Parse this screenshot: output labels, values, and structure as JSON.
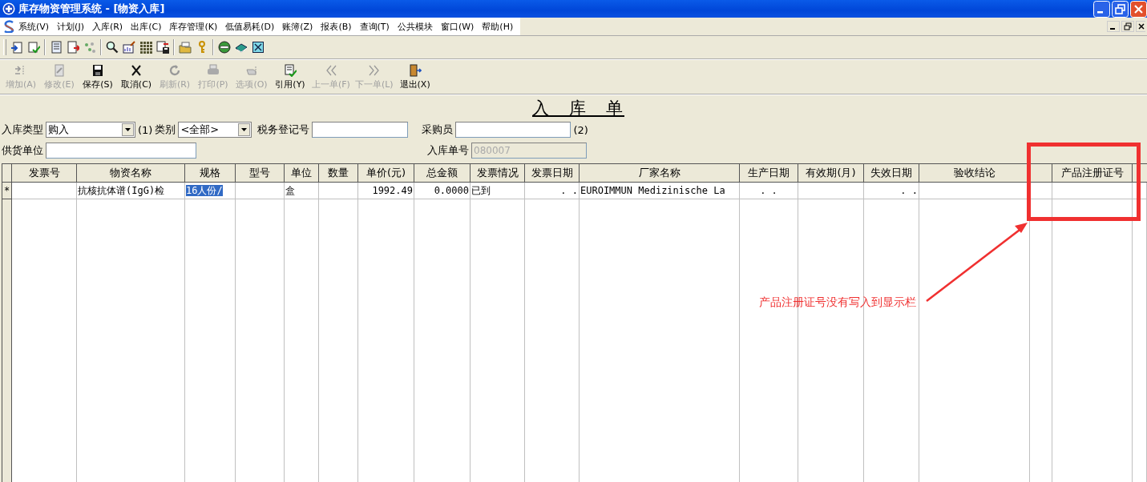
{
  "window": {
    "title": "库存物资管理系统 - [物资入库]"
  },
  "menu": [
    "系统(V)",
    "计划(J)",
    "入库(R)",
    "出库(C)",
    "库存管理(K)",
    "低值易耗(D)",
    "账簿(Z)",
    "报表(B)",
    "查询(T)",
    "公共模块",
    "窗口(W)",
    "帮助(H)"
  ],
  "actions": [
    {
      "label": "增加(A)",
      "disabled": true,
      "kind": "add"
    },
    {
      "label": "修改(E)",
      "disabled": true,
      "kind": "edit"
    },
    {
      "label": "保存(S)",
      "disabled": false,
      "kind": "save"
    },
    {
      "label": "取消(C)",
      "disabled": false,
      "kind": "cancel"
    },
    {
      "label": "刷新(R)",
      "disabled": true,
      "kind": "refresh"
    },
    {
      "label": "打印(P)",
      "disabled": true,
      "kind": "print"
    },
    {
      "label": "选项(O)",
      "disabled": true,
      "kind": "options"
    },
    {
      "label": "引用(Y)",
      "disabled": false,
      "kind": "quote"
    },
    {
      "label": "上一单(F)",
      "disabled": true,
      "kind": "prev"
    },
    {
      "label": "下一单(L)",
      "disabled": true,
      "kind": "next"
    },
    {
      "label": "退出(X)",
      "disabled": false,
      "kind": "exit"
    }
  ],
  "form": {
    "heading": "入　库　单",
    "entry_type": {
      "label": "入库类型",
      "value": "购入",
      "note": "(1)"
    },
    "category": {
      "label": "类别",
      "value": "<全部>"
    },
    "tax_no": {
      "label": "税务登记号"
    },
    "buyer": {
      "label": "采购员",
      "note": "(2)"
    },
    "supplier": {
      "label": "供货单位"
    },
    "receipt_no": {
      "label": "入库单号",
      "value": "080007",
      "disabled": true
    }
  },
  "table": {
    "columns": [
      {
        "label": "发票号"
      },
      {
        "label": "物资名称"
      },
      {
        "label": "规格"
      },
      {
        "label": "型号"
      },
      {
        "label": "单位"
      },
      {
        "label": "数量"
      },
      {
        "label": "单价(元)"
      },
      {
        "label": "总金额"
      },
      {
        "label": "发票情况"
      },
      {
        "label": "发票日期"
      },
      {
        "label": "厂家名称"
      },
      {
        "label": "生产日期"
      },
      {
        "label": "有效期(月)"
      },
      {
        "label": "失效日期"
      },
      {
        "label": "验收结论"
      },
      {
        "label": "产品注册证号"
      }
    ],
    "rows": [
      {
        "marker": "*",
        "cells": [
          {},
          {
            "text": "抗核抗体谱(IgG)检"
          },
          {
            "text": "16人份/",
            "selected": true
          },
          {},
          {
            "text": "盒"
          },
          {},
          {
            "text": "1992.49"
          },
          {
            "text": "0.0000"
          },
          {
            "text": "已到"
          },
          {
            "text": ". ."
          },
          {
            "text": "EUROIMMUN Medizinische La"
          },
          {
            "text": ". ."
          },
          {},
          {
            "text": ". ."
          },
          {},
          {},
          {}
        ]
      }
    ]
  },
  "annotation": {
    "text": "产品注册证号没有写入到显示栏"
  }
}
